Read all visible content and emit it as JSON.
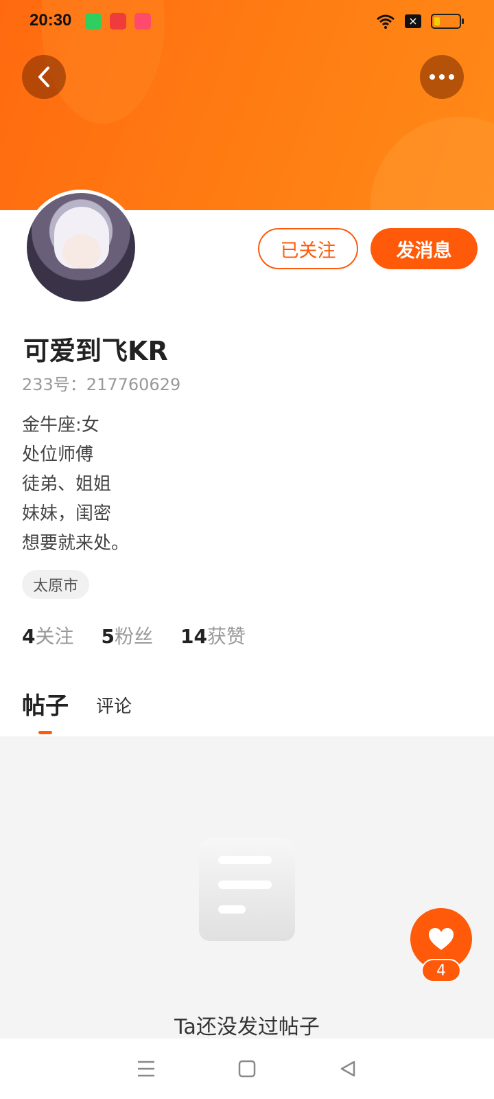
{
  "status_bar": {
    "time": "20:30",
    "app_icons": [
      "app-icon-green",
      "app-icon-red",
      "app-icon-pink"
    ],
    "icons": [
      "wifi-icon",
      "no-sim-icon",
      "battery-icon"
    ],
    "no_sim_glyph": "×"
  },
  "header": {
    "back_icon": "chevron-left-icon",
    "more_icon": "more-dots-icon"
  },
  "profile": {
    "avatar_icon": "avatar-icon",
    "follow_label": "已关注",
    "message_label": "发消息",
    "username": "可爱到飞KR",
    "id_text": "233号：217760629",
    "bio_lines": [
      "金牛座:女",
      "处位师傅",
      "徒弟、姐姐",
      "妹妹，闺密",
      "想要就来处。"
    ],
    "location": "太原市",
    "stats": [
      {
        "num": "4",
        "label": "关注"
      },
      {
        "num": "5",
        "label": "粉丝"
      },
      {
        "num": "14",
        "label": "获赞"
      }
    ]
  },
  "tabs": {
    "posts": "帖子",
    "comments": "评论"
  },
  "empty_state": {
    "icon": "empty-document-icon",
    "text": "Ta还没发过帖子"
  },
  "like_fab": {
    "icon": "heart-icon",
    "count": "4"
  },
  "nav_bar": {
    "icons": [
      "menu-icon",
      "home-square-icon",
      "back-triangle-icon"
    ]
  },
  "colors": {
    "accent": "#ff5a0a",
    "banner_start": "#ff6a10",
    "banner_end": "#ff8a18",
    "content_bg": "#f4f4f4"
  }
}
